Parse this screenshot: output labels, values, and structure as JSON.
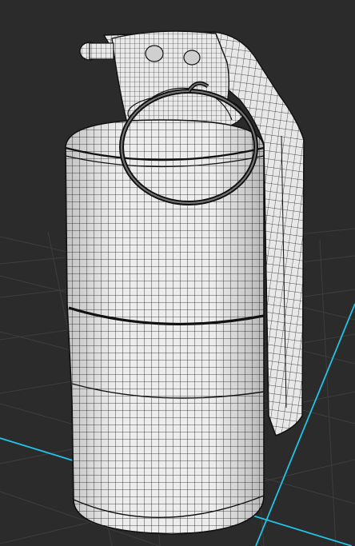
{
  "viewport": {
    "background": "#2b2b2b",
    "grid_color": "#3d3d3d",
    "axis_color": "#22c3e6"
  },
  "model": {
    "name": "grenade-wireframe",
    "surface_color": "#ececec",
    "wire_color": "#111111",
    "parts": [
      "body-canister",
      "spoon-lever",
      "pull-ring",
      "top-fuse"
    ]
  }
}
